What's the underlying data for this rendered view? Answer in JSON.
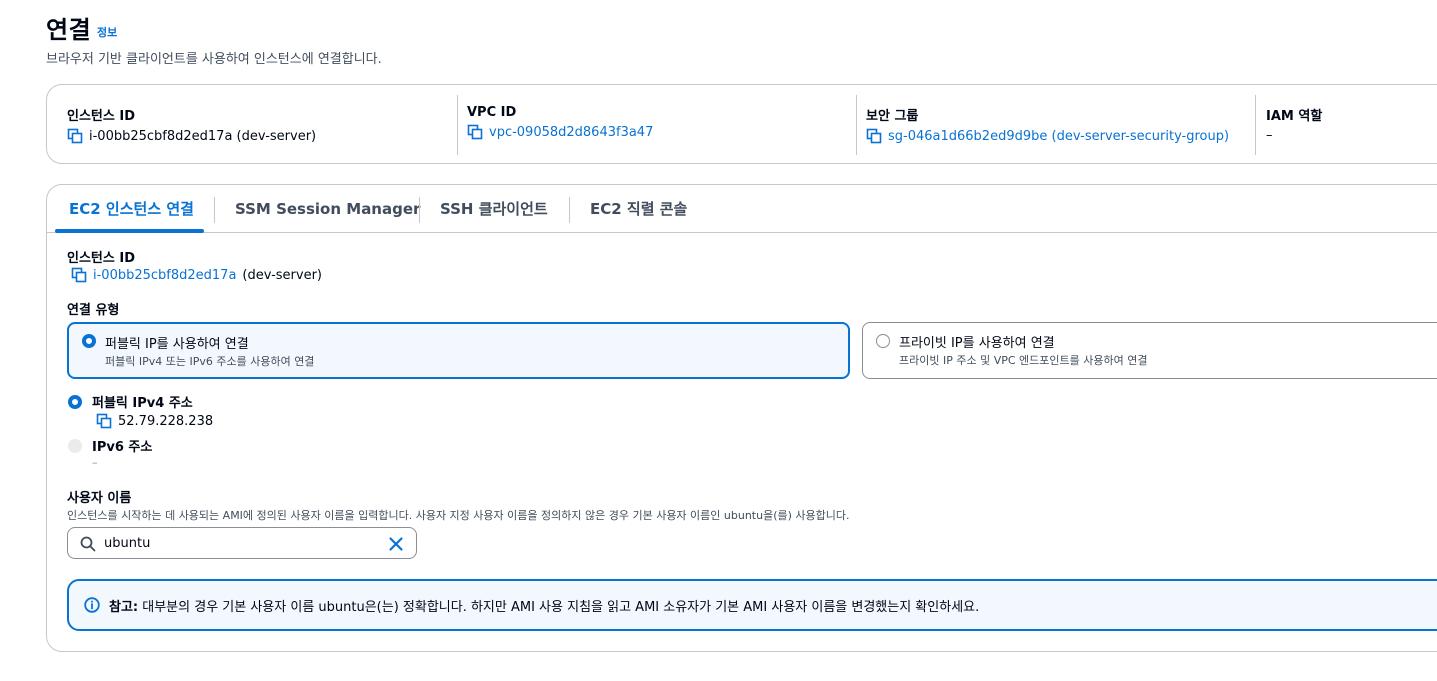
{
  "header": {
    "title": "연결",
    "info_link": "정보",
    "subtitle": "브라우저 기반 클라이언트를 사용하여 인스턴스에 연결합니다."
  },
  "summary": {
    "instance": {
      "label": "인스턴스 ID",
      "value": "i-00bb25cbf8d2ed17a (dev-server)"
    },
    "vpc": {
      "label": "VPC ID",
      "value": "vpc-09058d2d8643f3a47"
    },
    "security_group": {
      "label": "보안 그룹",
      "value": "sg-046a1d66b2ed9d9be (dev-server-security-group)"
    },
    "iam_role": {
      "label": "IAM 역할",
      "value": "–"
    }
  },
  "tabs": [
    {
      "label": "EC2 인스턴스 연결",
      "active": true
    },
    {
      "label": "SSM Session Manager",
      "active": false
    },
    {
      "label": "SSH 클라이언트",
      "active": false
    },
    {
      "label": "EC2 직렬 콘솔",
      "active": false
    }
  ],
  "form": {
    "instance_id_label": "인스턴스 ID",
    "instance_id_link": "i-00bb25cbf8d2ed17a",
    "instance_id_suffix": "(dev-server)",
    "connection_type_label": "연결 유형",
    "connection_types": [
      {
        "title": "퍼블릭 IP를 사용하여 연결",
        "description": "퍼블릭 IPv4 또는 IPv6 주소를 사용하여 연결",
        "selected": true
      },
      {
        "title": "프라이빗 IP를 사용하여 연결",
        "description": "프라이빗 IP 주소 및 VPC 엔드포인트를 사용하여 연결",
        "selected": false
      }
    ],
    "ipv4": {
      "label": "퍼블릭 IPv4 주소",
      "value": "52.79.228.238",
      "selected": true
    },
    "ipv6": {
      "label": "IPv6 주소",
      "value": "–",
      "selected": false
    },
    "username": {
      "label": "사용자 이름",
      "description": "인스턴스를 시작하는 데 사용되는 AMI에 정의된 사용자 이름을 입력합니다. 사용자 지정 사용자 이름을 정의하지 않은 경우 기본 사용자 이름인 ubuntu을(를) 사용합니다.",
      "value": "ubuntu"
    },
    "note": {
      "prefix": "참고:",
      "text": "대부분의 경우 기본 사용자 이름 ubuntu은(는) 정확합니다. 하지만 AMI 사용 지침을 읽고 AMI 소유자가 기본 AMI 사용자 이름을 변경했는지 확인하세요."
    }
  },
  "colors": {
    "accent": "#0972d3",
    "border": "#c6c6cd",
    "text": "#000716",
    "muted": "#414d5c"
  },
  "icons": [
    "copy-icon",
    "search-icon",
    "clear-icon",
    "info-circle-icon"
  ]
}
